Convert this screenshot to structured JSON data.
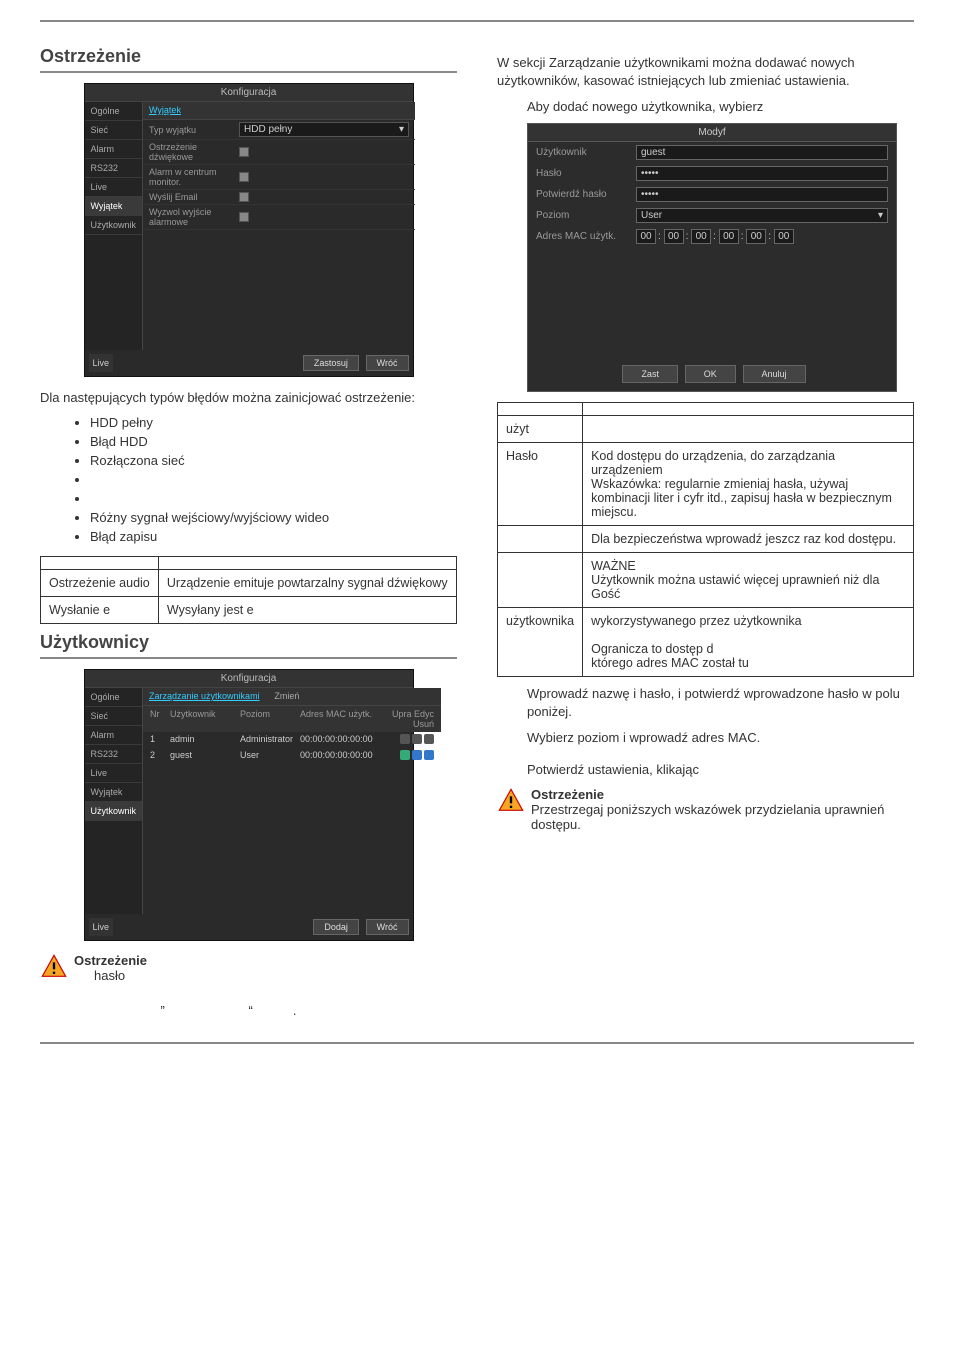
{
  "sections": {
    "warning_title": "Ostrzeżenie",
    "users_title": "Użytkownicy"
  },
  "cfg_panel": {
    "title": "Konfiguracja",
    "sidebar": [
      "Ogólne",
      "Sieć",
      "Alarm",
      "RS232",
      "Live",
      "Wyjątek",
      "Użytkownik"
    ],
    "tab_active": "Wyjątek",
    "rows": [
      {
        "label": "Typ wyjątku",
        "type": "dropdown",
        "value": "HDD pełny"
      },
      {
        "label": "Ostrzeżenie dźwiękowe",
        "type": "check"
      },
      {
        "label": "Alarm w centrum monitor.",
        "type": "check"
      },
      {
        "label": "Wyślij Email",
        "type": "check"
      },
      {
        "label": "Wyzwol wyjście alarmowe",
        "type": "check"
      }
    ],
    "live": "Live",
    "btn_apply": "Zastosuj",
    "btn_back": "Wróć"
  },
  "warn_intro": "Dla następujących typów błędów można zainicjować ostrzeżenie:",
  "warn_list": [
    "HDD pełny",
    "Błąd HDD",
    "Rozłączona sieć",
    "",
    "",
    "Różny sygnał wejściowy/wyjściowy wideo",
    "Błąd zapisu"
  ],
  "warn_table_h1": "",
  "warn_table_h2": "",
  "warn_table": [
    {
      "k": "Ostrzeżenie audio",
      "v": "Urządzenie emituje powtarzalny sygnał dźwiękowy"
    },
    {
      "k": "Wysłanie e",
      "v": "Wysyłany jest e"
    }
  ],
  "um_panel": {
    "title": "Konfiguracja",
    "sidebar": [
      "Ogólne",
      "Sieć",
      "Alarm",
      "RS232",
      "Live",
      "Wyjątek",
      "Użytkownik"
    ],
    "tabs": [
      "Zarządzanie użytkownikami",
      "Zmień"
    ],
    "headers": {
      "nr": "Nr",
      "user": "Użytkownik",
      "level": "Poziom",
      "mac": "Adres MAC użytk.",
      "act": "Upra Edyc Usuń"
    },
    "rows": [
      {
        "nr": "1",
        "user": "admin",
        "level": "Administrator",
        "mac": "00:00:00:00:00:00",
        "canEdit": false
      },
      {
        "nr": "2",
        "user": "guest",
        "level": "User",
        "mac": "00:00:00:00:00:00",
        "canEdit": true
      }
    ],
    "live": "Live",
    "btn_add": "Dodaj",
    "btn_back": "Wróć"
  },
  "left_warn": {
    "title": "Ostrzeżenie",
    "text": "hasło"
  },
  "quotes": "”        “.",
  "right_intro": "W sekcji Zarządzanie użytkownikami można dodawać nowych użytkowników, kasować istniejących lub zmieniać ustawienia.",
  "right_step": "Aby dodać nowego użytkownika, wybierz",
  "modify": {
    "title": "Modyf",
    "rows": {
      "user_l": "Użytkownik",
      "user_v": "guest",
      "pass_l": "Hasło",
      "pass_v": "•••••",
      "conf_l": "Potwierdź hasło",
      "conf_v": "•••••",
      "level_l": "Poziom",
      "level_v": "User",
      "mac_l": "Adres MAC użytk.",
      "mac_v": [
        "00",
        "00",
        "00",
        "00",
        "00",
        "00"
      ]
    },
    "btn_apply": "Zast",
    "btn_ok": "OK",
    "btn_cancel": "Anuluj"
  },
  "right_table": [
    {
      "k": "",
      "v": ""
    },
    {
      "k": "użyt",
      "v": ""
    },
    {
      "k": "Hasło",
      "v": "Kod dostępu do urządzenia, do zarządzania urządzeniem\nWskazówka: regularnie zmieniaj hasła, używaj kombinacji liter i cyfr itd., zapisuj hasła w bezpiecznym miejscu."
    },
    {
      "k": "",
      "v": "Dla bezpieczeństwa wprowadź jeszcz raz kod dostępu."
    },
    {
      "k": "",
      "v": "WAŻNE\n                    Użytkownik można ustawić więcej uprawnień niż dla                     Gość"
    },
    {
      "k": "użytkownika",
      "v": "wykorzystywanego przez użytkownika\n\nOgranicza to dostęp d\nktórego adres MAC został tu"
    }
  ],
  "right_steps": [
    "Wprowadź nazwę i hasło, i potwierdź wprowadzone hasło w polu poniżej.",
    "Wybierz poziom i wprowadź adres MAC.",
    "Potwierdź ustawienia, klikając"
  ],
  "right_warn": {
    "title": "Ostrzeżenie",
    "text": "Przestrzegaj poniższych wskazówek przydzielania uprawnień dostępu."
  }
}
